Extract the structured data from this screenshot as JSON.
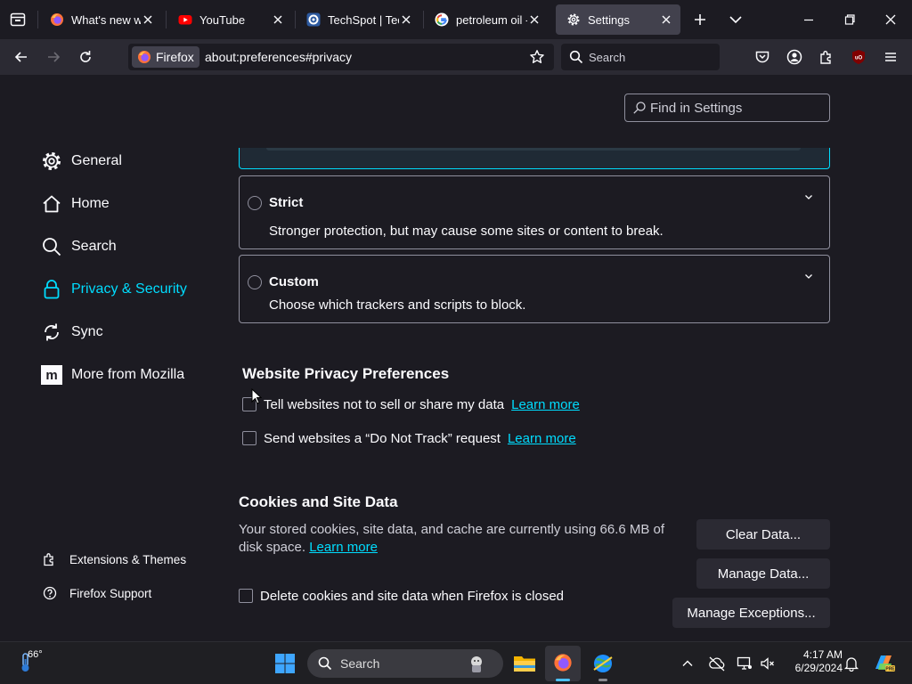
{
  "tabs": [
    {
      "title": "What's new with",
      "icon": "firefox-icon"
    },
    {
      "title": "YouTube",
      "icon": "youtube-icon"
    },
    {
      "title": "TechSpot | Tech",
      "icon": "techspot-icon"
    },
    {
      "title": "petroleum oil - G",
      "icon": "google-icon"
    },
    {
      "title": "Settings",
      "icon": "gear-icon",
      "selected": true
    }
  ],
  "navbar": {
    "identity_label": "Firefox",
    "url": "about:preferences#privacy",
    "search_placeholder": "Search"
  },
  "find": {
    "placeholder": "Find in Settings"
  },
  "sidebar": {
    "categories": [
      {
        "label": "General",
        "icon": "gear-icon"
      },
      {
        "label": "Home",
        "icon": "home-icon"
      },
      {
        "label": "Search",
        "icon": "search-icon"
      },
      {
        "label": "Privacy & Security",
        "icon": "lock-icon",
        "selected": true
      },
      {
        "label": "Sync",
        "icon": "sync-icon"
      },
      {
        "label": "More from Mozilla",
        "icon": "mozilla-icon"
      }
    ],
    "footer": [
      {
        "label": "Extensions & Themes",
        "icon": "puzzle-icon"
      },
      {
        "label": "Firefox Support",
        "icon": "help-icon"
      }
    ]
  },
  "tracking": {
    "strict_title": "Strict",
    "strict_desc": "Stronger protection, but may cause some sites or content to break.",
    "custom_title": "Custom",
    "custom_desc": "Choose which trackers and scripts to block."
  },
  "privacy_prefs": {
    "heading": "Website Privacy Preferences",
    "gpc_label": "Tell websites not to sell or share my data",
    "dnt_label": "Send websites a “Do Not Track” request",
    "learn_more": "Learn more"
  },
  "cookies": {
    "heading": "Cookies and Site Data",
    "desc_line1": "Your stored cookies, site data, and cache are currently using 66.6 MB of",
    "desc_line2": "disk space.",
    "learn_more": "Learn more",
    "clear_button": "Clear Data...",
    "manage_button": "Manage Data...",
    "exceptions_button": "Manage Exceptions...",
    "delete_on_close_label": "Delete cookies and site data when Firefox is closed"
  },
  "taskbar": {
    "weather_temp": "66°",
    "search_placeholder": "Search",
    "time": "4:17 AM",
    "date": "6/29/2024"
  },
  "colors": {
    "accent": "#00ddff",
    "background": "#1c1b22",
    "toolbar": "#2b2a33"
  }
}
